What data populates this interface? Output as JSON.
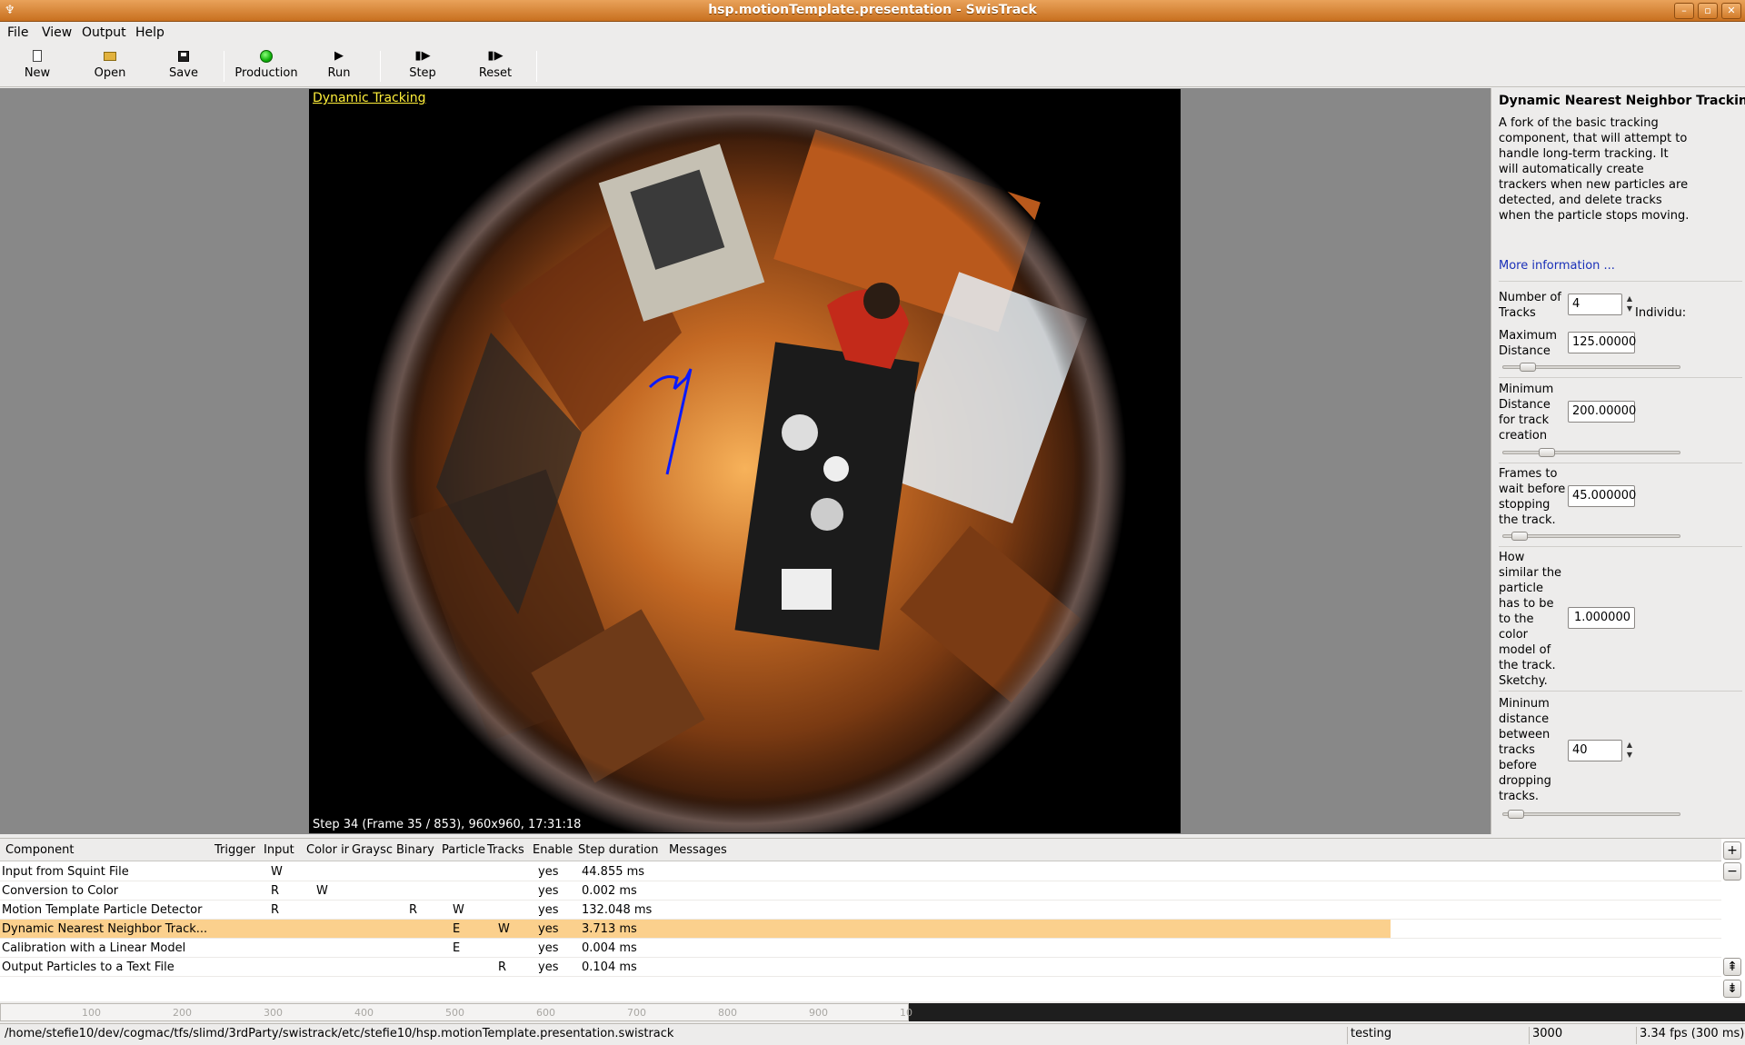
{
  "window": {
    "title": "hsp.motionTemplate.presentation - SwisTrack"
  },
  "menu": [
    "File",
    "View",
    "Output",
    "Help"
  ],
  "toolbar": {
    "new": "New",
    "open": "Open",
    "save": "Save",
    "production": "Production",
    "run": "Run",
    "step": "Step",
    "reset": "Reset"
  },
  "display": {
    "label": "Dynamic Tracking",
    "step_info": "Step 34 (Frame 35 / 853), 960x960, 17:31:18"
  },
  "panel": {
    "title": "Dynamic Nearest Neighbor Tracking",
    "description": "A fork of the basic tracking component, that will attempt to handle long-term tracking. It will automatically create trackers when new particles are detected, and delete tracks when the particle stops moving.",
    "more_info": "More information ...",
    "params": {
      "num_tracks": {
        "label": "Number of Tracks",
        "value": "4",
        "suffix": "Individu:"
      },
      "max_distance": {
        "label": "Maximum Distance",
        "value": "125.00000",
        "slider": 0.1
      },
      "min_distance_creation": {
        "label": "Minimum Distance for track creation",
        "value": "200.00000",
        "slider": 0.22
      },
      "frames_to_wait": {
        "label": "Frames to wait before stopping the track.",
        "value": "45.000000",
        "slider": 0.05
      },
      "similarity": {
        "label": "How similar the particle has to be to the color model of the track. Sketchy.",
        "value": "1.000000"
      },
      "min_distance_drop": {
        "label": "Mininum distance between tracks before dropping tracks.",
        "value": "40",
        "slider": 0.03
      }
    }
  },
  "table": {
    "headers": [
      "Component",
      "Trigger",
      "Input",
      "Color ir",
      "Graysc",
      "Binary",
      "Particle",
      "Tracks",
      "Enable",
      "Step duration",
      "Messages"
    ],
    "rows": [
      {
        "component": "Input from Squint File",
        "input": "W",
        "color": "",
        "binary": "",
        "particle": "",
        "tracks": "",
        "enable": "yes",
        "duration": "44.855 ms",
        "selected": false
      },
      {
        "component": "Conversion to Color",
        "input": "R",
        "color": "W",
        "binary": "",
        "particle": "",
        "tracks": "",
        "enable": "yes",
        "duration": "0.002 ms",
        "selected": false
      },
      {
        "component": "Motion Template Particle Detector",
        "input": "R",
        "color": "",
        "binary": "R",
        "particle": "W",
        "tracks": "",
        "enable": "yes",
        "duration": "132.048 ms",
        "selected": false
      },
      {
        "component": "Dynamic Nearest Neighbor Track...",
        "input": "",
        "color": "",
        "binary": "",
        "particle": "E",
        "tracks": "W",
        "enable": "yes",
        "duration": "3.713 ms",
        "selected": true
      },
      {
        "component": "Calibration with a Linear Model",
        "input": "",
        "color": "",
        "binary": "",
        "particle": "E",
        "tracks": "",
        "enable": "yes",
        "duration": "0.004 ms",
        "selected": false
      },
      {
        "component": "Output Particles to a Text File",
        "input": "",
        "color": "",
        "binary": "",
        "particle": "",
        "tracks": "R",
        "enable": "yes",
        "duration": "0.104 ms",
        "selected": false
      }
    ]
  },
  "timeline": {
    "ticks": [
      "100",
      "200",
      "300",
      "400",
      "500",
      "600",
      "700",
      "800",
      "900",
      "10"
    ]
  },
  "status": {
    "path": "/home/stefie10/dev/cogmac/tfs/slimd/3rdParty/swistrack/etc/stefie10/hsp.motionTemplate.presentation.swistrack",
    "mode": "testing",
    "port": "3000",
    "fps": "3.34 fps (300 ms)"
  }
}
